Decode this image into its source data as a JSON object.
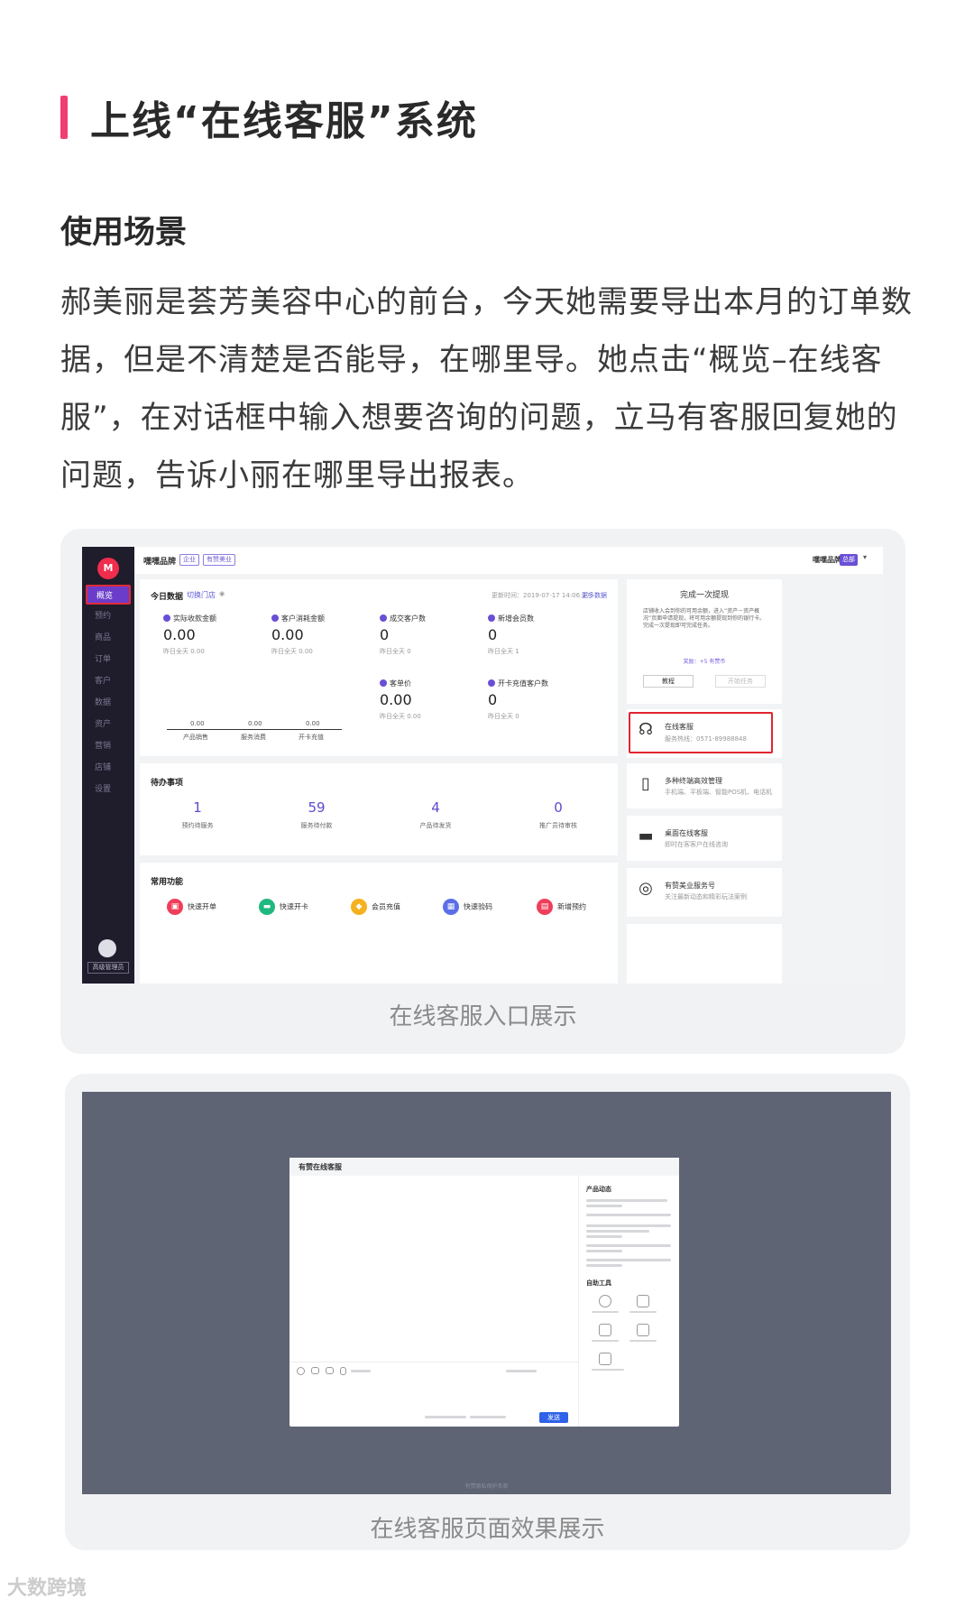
{
  "heading": "上线“在线客服”系统",
  "subheading": "使用场景",
  "paragraph": "郝美丽是荟芳美容中心的前台，今天她需要导出本月的订单数据，但是不清楚是否能导，在哪里导。她点击“概览–在线客服”，在对话框中输入想要咨询的问题，立马有客服回复她的问题，告诉小丽在哪里导出报表。",
  "screenshot1": {
    "caption": "在线客服入口展示",
    "brand": "嘿嘿品牌",
    "brand_chips": [
      "企业",
      "有赞美业"
    ],
    "brand_right": "嘿嘿品牌",
    "brand_right_chip": "总部",
    "sidebar": {
      "items": [
        "概览",
        "预约",
        "商品",
        "订单",
        "客户",
        "数据",
        "资产",
        "营销",
        "店铺",
        "设置"
      ],
      "admin": "高级管理员"
    },
    "today": {
      "title": "今日数据",
      "switch": "切换门店",
      "update": "更新时间：2019-07-17 14:06:37",
      "more": "更多数据",
      "metrics": [
        {
          "label": "实际收款金额",
          "value": "0.00",
          "yesterday": "昨日全天  0.00"
        },
        {
          "label": "客户消耗金额",
          "value": "0.00",
          "yesterday": "昨日全天  0.00"
        },
        {
          "label": "成交客户数",
          "value": "0",
          "yesterday": "昨日全天  0"
        },
        {
          "label": "新增会员数",
          "value": "0",
          "yesterday": "昨日全天  1"
        },
        {
          "label": "客单价",
          "value": "0.00",
          "yesterday": "昨日全天  0.00"
        },
        {
          "label": "开卡充值客户数",
          "value": "0",
          "yesterday": "昨日全天  0"
        }
      ],
      "mini_chart": {
        "values": [
          "0.00",
          "0.00",
          "0.00"
        ],
        "labels": [
          "产品销售",
          "服务消费",
          "开卡充值"
        ]
      }
    },
    "todo": {
      "title": "待办事项",
      "items": [
        {
          "value": "1",
          "label": "预约待服务"
        },
        {
          "value": "59",
          "label": "服务待付款"
        },
        {
          "value": "4",
          "label": "产品待发货"
        },
        {
          "value": "0",
          "label": "推广员待审核"
        }
      ]
    },
    "common": {
      "title": "常用功能",
      "items": [
        {
          "label": "快速开单",
          "color": "#ef3f5a"
        },
        {
          "label": "快速开卡",
          "color": "#1fb87e"
        },
        {
          "label": "会员充值",
          "color": "#f5b21e"
        },
        {
          "label": "快速验码",
          "color": "#5b6ee8"
        },
        {
          "label": "新增预约",
          "color": "#ef3f5a"
        }
      ]
    },
    "task": {
      "title": "完成一次提现",
      "desc": "店铺收入会到你的可用余额，进入“资产－资产概况”页面申请提现，将可用余额提现到你的银行卡。完成一次提现即可完成任务。",
      "reward": "奖励：+5 有赞币",
      "btn_tutorial": "教程",
      "btn_start": "开始任务"
    },
    "service_cards": [
      {
        "title": "在线客服",
        "sub": "服务热线：0571-89988848",
        "icon": "headset-icon"
      },
      {
        "title": "多种终端高效管理",
        "sub": "手机端、平板端、智能POS机、电话机",
        "icon": "devices-icon"
      },
      {
        "title": "桌面在线客服",
        "sub": "即时在客客户在线咨询",
        "icon": "desktop-icon"
      },
      {
        "title": "有赞美业服务号",
        "sub": "关注最新动态和精彩玩法案例",
        "icon": "wechat-icon"
      }
    ]
  },
  "screenshot2": {
    "caption": "在线客服页面效果展示",
    "chat_title": "有赞在线客服",
    "side_news_title": "产品动态",
    "side_tools_title": "自助工具",
    "send": "发送",
    "footer": "有赞隐私保护条款"
  },
  "watermark": "大数跨境"
}
